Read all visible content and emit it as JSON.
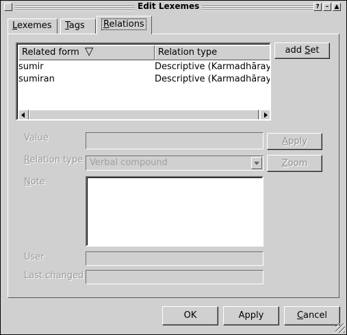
{
  "window": {
    "title": "Edit Lexemes",
    "help_glyph": "?",
    "minimize_glyph": "–",
    "maximize_glyph": "▲"
  },
  "tabs": [
    {
      "label": "Lexemes",
      "mnemonic": "L",
      "rest": "exemes"
    },
    {
      "label": "Tags",
      "mnemonic": "T",
      "rest": "ags"
    },
    {
      "label": "Relations",
      "mnemonic": "R",
      "rest": "elations"
    }
  ],
  "relations_list": {
    "columns": [
      "Related form",
      "Relation type"
    ],
    "sort_indicator": "▽",
    "rows": [
      {
        "form": "sumir",
        "type": "Descriptive (Karmadhāraya)"
      },
      {
        "form": "sumiran",
        "type": "Descriptive (Karmadhāraya)"
      }
    ]
  },
  "buttons": {
    "add_set": {
      "prefix": "add ",
      "mnemonic": "S",
      "rest": "et"
    },
    "apply_side": {
      "mnemonic": "A",
      "rest": "pply"
    },
    "zoom": {
      "mnemonic": "Z",
      "rest": "oom"
    },
    "ok": "OK",
    "apply": "Apply",
    "cancel": {
      "mnemonic": "C",
      "rest": "ancel"
    }
  },
  "form": {
    "value_label": "Value",
    "relation_type_label": {
      "mnemonic": "R",
      "rest": "elation type"
    },
    "relation_type_selected": "Verbal compound",
    "note_label": {
      "mnemonic": "N",
      "rest": "ote"
    },
    "user_label": "User",
    "last_changed_label": "Last changed"
  }
}
